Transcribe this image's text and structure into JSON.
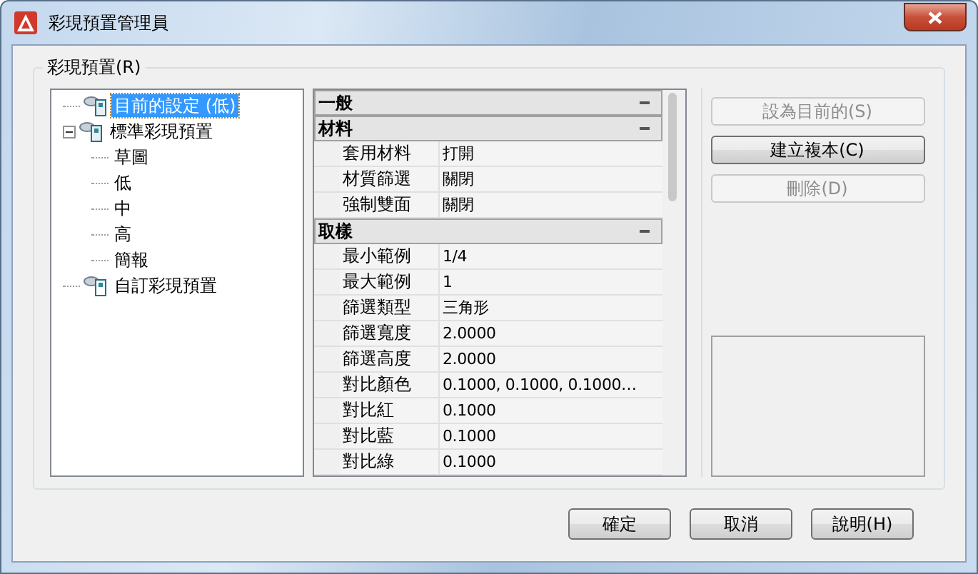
{
  "window": {
    "title": "彩現預置管理員"
  },
  "group": {
    "label": "彩現預置(R)"
  },
  "tree": [
    {
      "label": "目前的設定 (低)",
      "selected": true,
      "kind": "current"
    },
    {
      "label": "標準彩現預置",
      "selected": false,
      "expanded": true,
      "kind": "standard",
      "children": [
        {
          "label": "草圖",
          "selected": false
        },
        {
          "label": "低",
          "selected": false
        },
        {
          "label": "中",
          "selected": false
        },
        {
          "label": "高",
          "selected": false
        },
        {
          "label": "簡報",
          "selected": false
        }
      ]
    },
    {
      "label": "自訂彩現預置",
      "selected": false,
      "kind": "custom"
    }
  ],
  "properties": [
    {
      "title": "一般",
      "expanded": true
    },
    {
      "title": "材料",
      "expanded": true,
      "rows": [
        {
          "name": "套用材料",
          "value": "打開"
        },
        {
          "name": "材質篩選",
          "value": "關閉"
        },
        {
          "name": "強制雙面",
          "value": "關閉"
        }
      ]
    },
    {
      "title": "取樣",
      "expanded": true,
      "rows": [
        {
          "name": "最小範例",
          "value": "1/4"
        },
        {
          "name": "最大範例",
          "value": "1"
        },
        {
          "name": "篩選類型",
          "value": "三角形"
        },
        {
          "name": "篩選寬度",
          "value": "2.0000"
        },
        {
          "name": "篩選高度",
          "value": "2.0000"
        },
        {
          "name": "對比顏色",
          "value": "0.1000, 0.1000, 0.1000…"
        },
        {
          "name": "對比紅",
          "value": "0.1000"
        },
        {
          "name": "對比藍",
          "value": "0.1000"
        },
        {
          "name": "對比綠",
          "value": "0.1000"
        }
      ]
    }
  ],
  "side_buttons": [
    {
      "label": "設為目前的(S)",
      "disabled": true
    },
    {
      "label": "建立複本(C)",
      "disabled": false
    },
    {
      "label": "刪除(D)",
      "disabled": true
    }
  ],
  "buttons": [
    {
      "label": "確定"
    },
    {
      "label": "取消"
    },
    {
      "label": "說明(H)"
    }
  ]
}
